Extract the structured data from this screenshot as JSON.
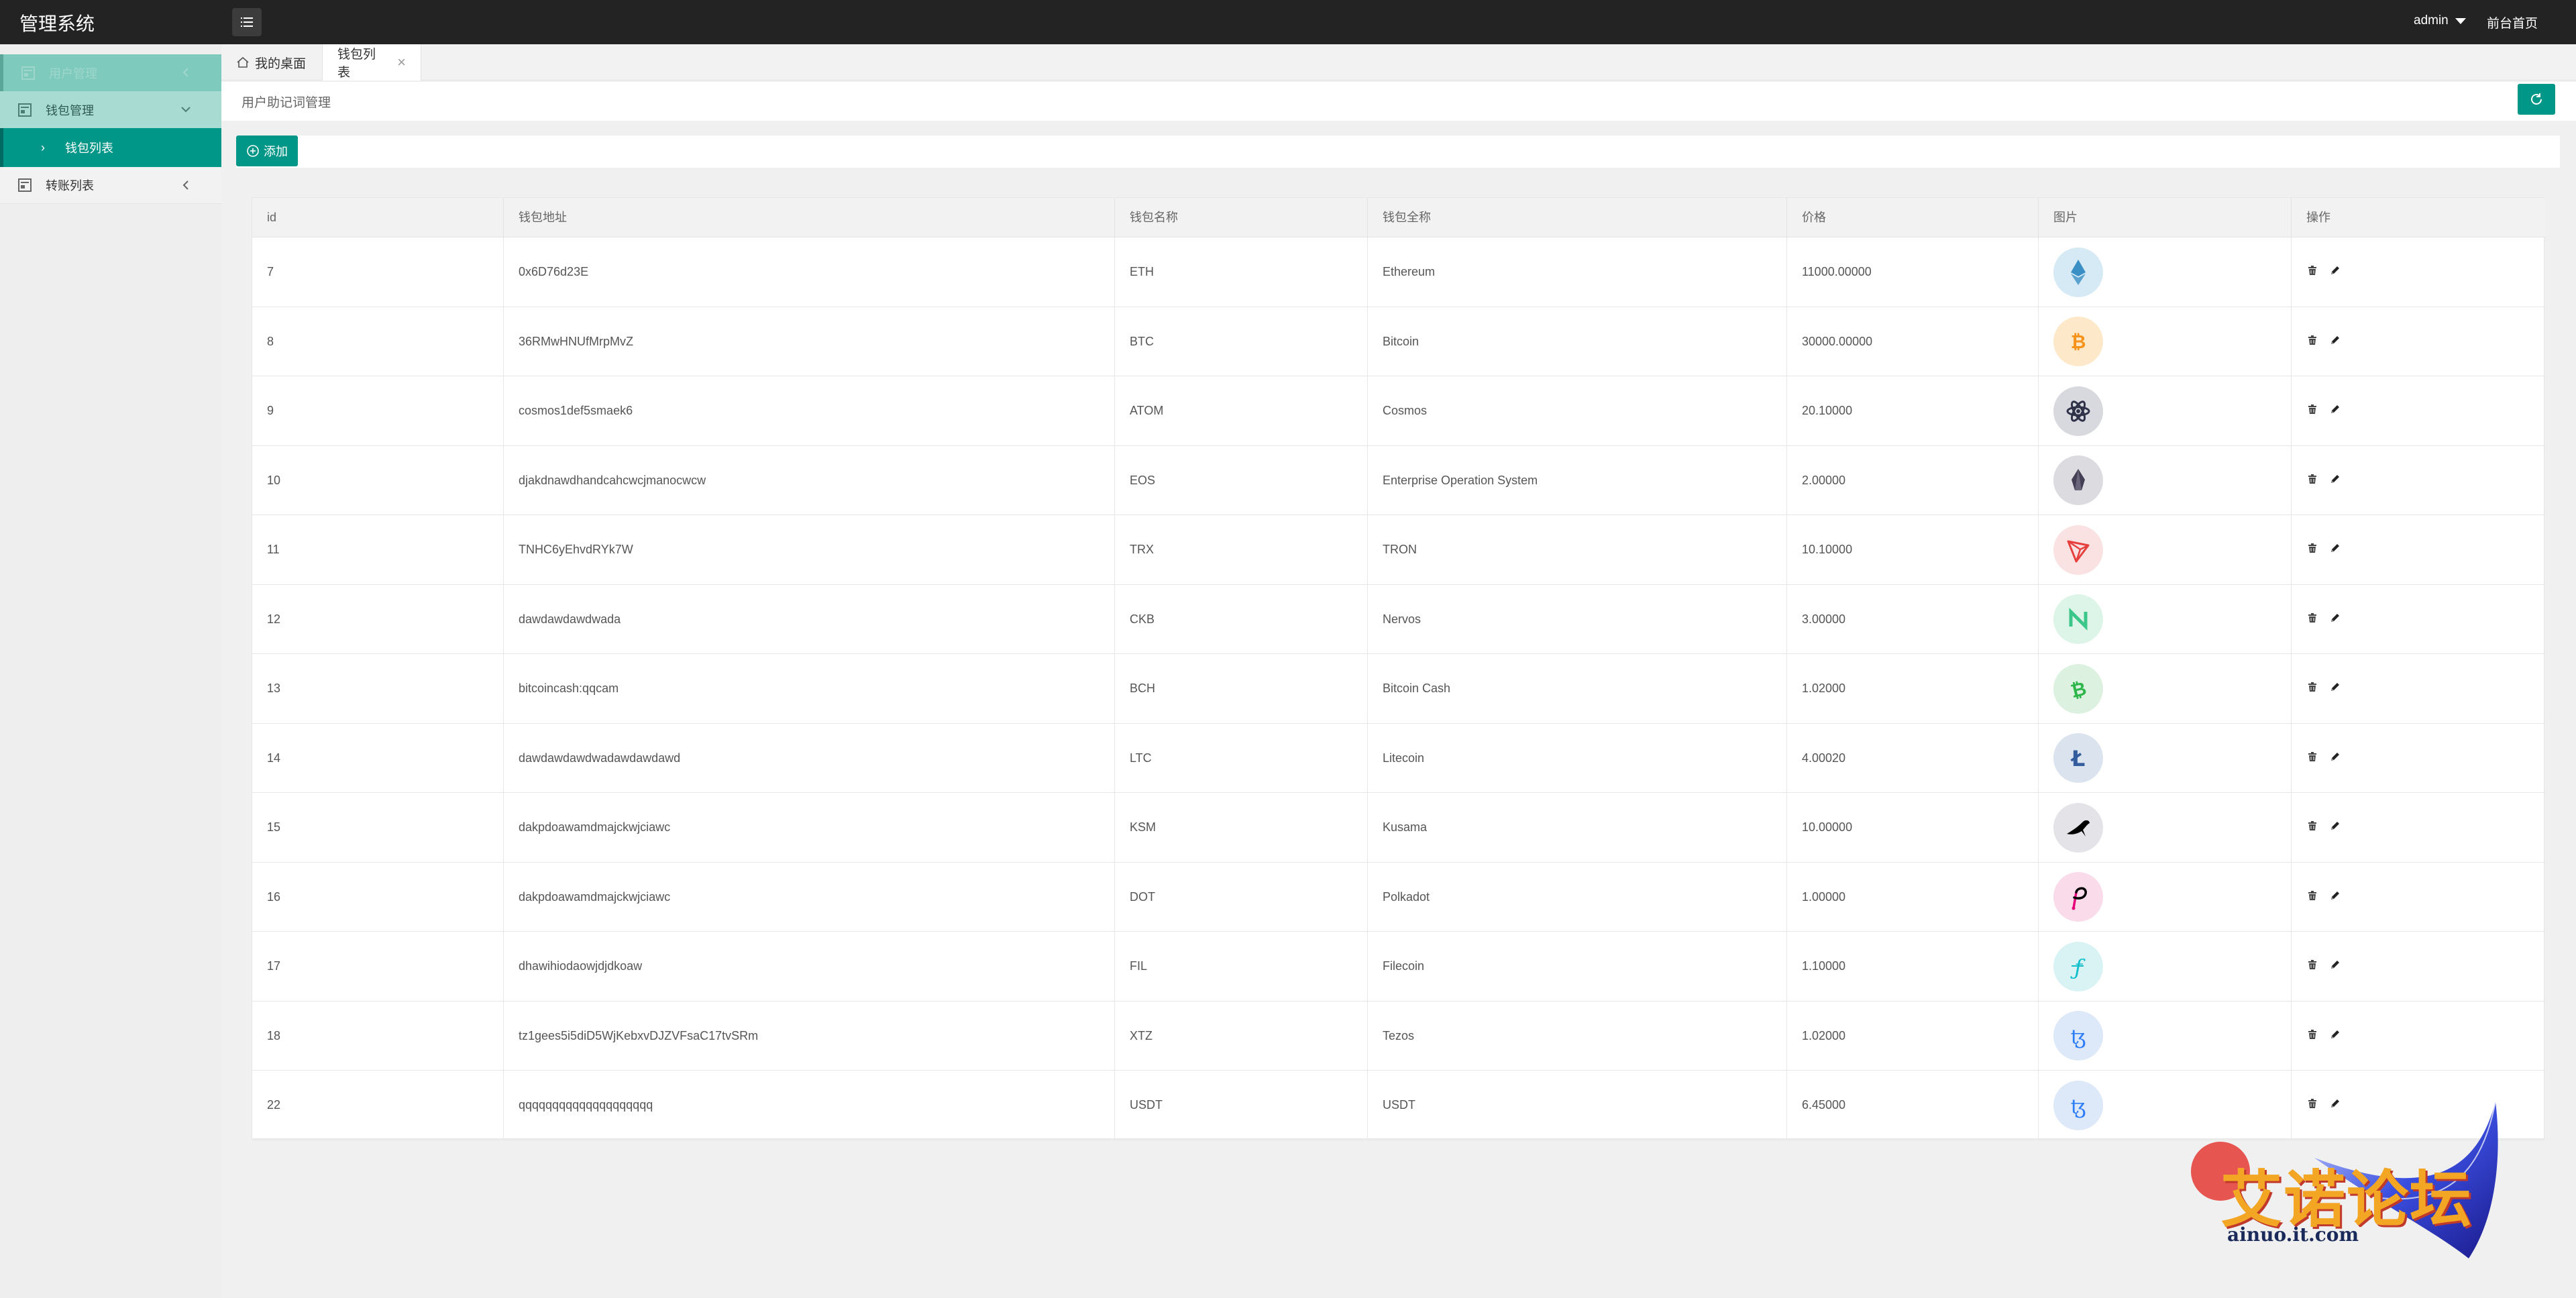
{
  "header": {
    "brand": "管理系统",
    "user": "admin",
    "home_link": "前台首页"
  },
  "sidebar": {
    "items": [
      {
        "label": "用户管理",
        "icon": "document-icon"
      },
      {
        "label": "钱包管理",
        "icon": "document-icon"
      },
      {
        "label": "钱包列表",
        "icon": "chevron-right-icon"
      },
      {
        "label": "转账列表",
        "icon": "document-icon"
      }
    ]
  },
  "tabs": [
    {
      "label": "我的桌面",
      "icon": "home-icon"
    },
    {
      "label": "钱包列表",
      "active": true
    }
  ],
  "breadcrumb": "用户助记词管理",
  "toolbar": {
    "add_label": "添加"
  },
  "table": {
    "columns": [
      "id",
      "钱包地址",
      "钱包名称",
      "钱包全称",
      "价格",
      "图片",
      "操作"
    ],
    "rows": [
      {
        "id": "7",
        "address": "0x6D76d23E",
        "name": "ETH",
        "fullname": "Ethereum",
        "price": "11000.00000",
        "icon": "ethereum-logo",
        "color": "#3a8fc4",
        "bg": "#d6eaf5"
      },
      {
        "id": "8",
        "address": "36RMwHNUfMrpMvZ",
        "name": "BTC",
        "fullname": "Bitcoin",
        "price": "30000.00000",
        "icon": "bitcoin-logo",
        "color": "#f7931a",
        "bg": "#fde9c9"
      },
      {
        "id": "9",
        "address": "cosmos1def5smaek6",
        "name": "ATOM",
        "fullname": "Cosmos",
        "price": "20.10000",
        "icon": "cosmos-logo",
        "color": "#2e3148",
        "bg": "#d8d9de"
      },
      {
        "id": "10",
        "address": "djakdnawdhandcahcwcjmanocwcw",
        "name": "EOS",
        "fullname": "Enterprise Operation System",
        "price": "2.00000",
        "icon": "eos-logo",
        "color": "#443f54",
        "bg": "#dcdbe0"
      },
      {
        "id": "11",
        "address": "TNHC6yEhvdRYk7W",
        "name": "TRX",
        "fullname": "TRON",
        "price": "10.10000",
        "icon": "tron-logo",
        "color": "#e5403d",
        "bg": "#fbe2e2"
      },
      {
        "id": "12",
        "address": "dawdawdawdwada",
        "name": "CKB",
        "fullname": "Nervos",
        "price": "3.00000",
        "icon": "nervos-logo",
        "color": "#3cc68a",
        "bg": "#ddf4e8"
      },
      {
        "id": "13",
        "address": "bitcoincash:qqcam",
        "name": "BCH",
        "fullname": "Bitcoin Cash",
        "price": "1.02000",
        "icon": "bitcoin-cash-logo",
        "color": "#2fb64a",
        "bg": "#dcf1df"
      },
      {
        "id": "14",
        "address": "dawdawdawdwadawdawdawd",
        "name": "LTC",
        "fullname": "Litecoin",
        "price": "4.00020",
        "icon": "litecoin-logo",
        "color": "#345d9d",
        "bg": "#dbe3ee"
      },
      {
        "id": "15",
        "address": "dakpdoawamdmajckwjciawc",
        "name": "KSM",
        "fullname": "Kusama",
        "price": "10.00000",
        "icon": "kusama-logo",
        "color": "#000000",
        "bg": "#e4e4e8"
      },
      {
        "id": "16",
        "address": "dakpdoawamdmajckwjciawc",
        "name": "DOT",
        "fullname": "Polkadot",
        "price": "1.00000",
        "icon": "polkadot-logo",
        "color": "#e6007a",
        "bg": "#fadbea"
      },
      {
        "id": "17",
        "address": "dhawihiodaowjdjdkoaw",
        "name": "FIL",
        "fullname": "Filecoin",
        "price": "1.10000",
        "icon": "filecoin-logo",
        "color": "#0fbfcc",
        "bg": "#d9f2f4"
      },
      {
        "id": "18",
        "address": "tz1gees5i5diD5WjKebxvDJZVFsaC17tvSRm",
        "name": "XTZ",
        "fullname": "Tezos",
        "price": "1.02000",
        "icon": "tezos-logo",
        "color": "#2c7df7",
        "bg": "#dde8f8"
      },
      {
        "id": "22",
        "address": "qqqqqqqqqqqqqqqqqqqq",
        "name": "USDT",
        "fullname": "USDT",
        "price": "6.45000",
        "icon": "tezos-logo",
        "color": "#2c7df7",
        "bg": "#dde8f8"
      }
    ]
  },
  "watermark": {
    "title": "艾诺论坛",
    "subtitle": "ainuo.it.com"
  },
  "colors": {
    "accent": "#009688",
    "topbar": "#232323",
    "sidebar_active": "#009688"
  }
}
